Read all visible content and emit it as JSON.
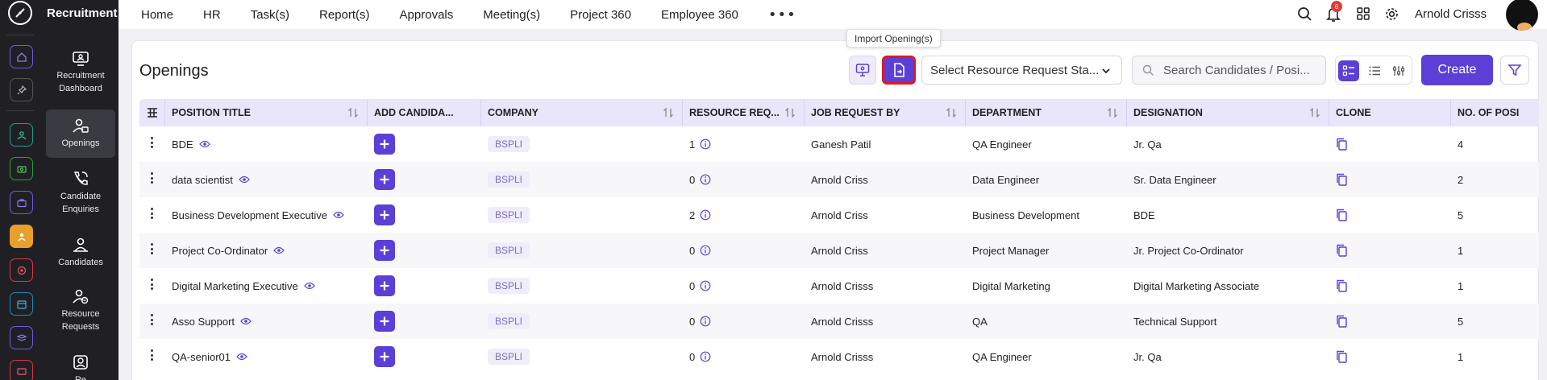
{
  "module": {
    "title": "Recruitment",
    "items": [
      {
        "label": "Recruitment Dashboard",
        "icon": "dashboard-icon"
      },
      {
        "label": "Openings",
        "icon": "openings-icon",
        "active": true
      },
      {
        "label": "Candidate Enquiries",
        "icon": "phone-icon"
      },
      {
        "label": "Candidates",
        "icon": "candidates-icon"
      },
      {
        "label": "Resource Requests",
        "icon": "resource-icon"
      },
      {
        "label": "Re",
        "icon": "person-icon"
      }
    ]
  },
  "nav": {
    "items": [
      "Home",
      "HR",
      "Task(s)",
      "Report(s)",
      "Approvals",
      "Meeting(s)",
      "Project 360",
      "Employee 360"
    ],
    "more": "•••"
  },
  "header": {
    "notification_count": "6",
    "user_name": "Arnold Crisss"
  },
  "toolbar": {
    "page_title": "Openings",
    "tooltip": "Import Opening(s)",
    "select_placeholder": "Select Resource Request Sta...",
    "search_placeholder": "Search Candidates / Posi...",
    "create_label": "Create",
    "highlight_color": "#e0191f",
    "accent_color": "#5b3fd6"
  },
  "table": {
    "headers": [
      "POSITION TITLE",
      "ADD CANDIDA...",
      "COMPANY",
      "RESOURCE REQ...",
      "JOB REQUEST BY",
      "DEPARTMENT",
      "DESIGNATION",
      "CLONE",
      "NO. OF POSI"
    ],
    "rows": [
      {
        "title": "BDE",
        "company": "BSPLI",
        "resource": "1",
        "requested_by": "Ganesh Patil",
        "department": "QA Engineer",
        "designation": "Jr. Qa",
        "positions": "4"
      },
      {
        "title": "data scientist",
        "company": "BSPLI",
        "resource": "0",
        "requested_by": "Arnold Criss",
        "department": "Data Engineer",
        "designation": "Sr. Data Engineer",
        "positions": "2"
      },
      {
        "title": "Business Development Executive",
        "company": "BSPLI",
        "resource": "2",
        "requested_by": "Arnold Criss",
        "department": "Business Development",
        "designation": "BDE",
        "positions": "5"
      },
      {
        "title": "Project Co-Ordinator",
        "company": "BSPLI",
        "resource": "0",
        "requested_by": "Arnold Criss",
        "department": "Project Manager",
        "designation": "Jr. Project Co-Ordinator",
        "positions": "1"
      },
      {
        "title": "Digital Marketing Executive",
        "company": "BSPLI",
        "resource": "0",
        "requested_by": "Arnold Crisss",
        "department": "Digital Marketing",
        "designation": "Digital Marketing Associate",
        "positions": "1"
      },
      {
        "title": "Asso Support",
        "company": "BSPLI",
        "resource": "0",
        "requested_by": "Arnold Crisss",
        "department": "QA",
        "designation": "Technical Support",
        "positions": "5"
      },
      {
        "title": "QA-senior01",
        "company": "BSPLI",
        "resource": "0",
        "requested_by": "Arnold Crisss",
        "department": "QA Engineer",
        "designation": "Jr. Qa",
        "positions": "1"
      }
    ]
  }
}
